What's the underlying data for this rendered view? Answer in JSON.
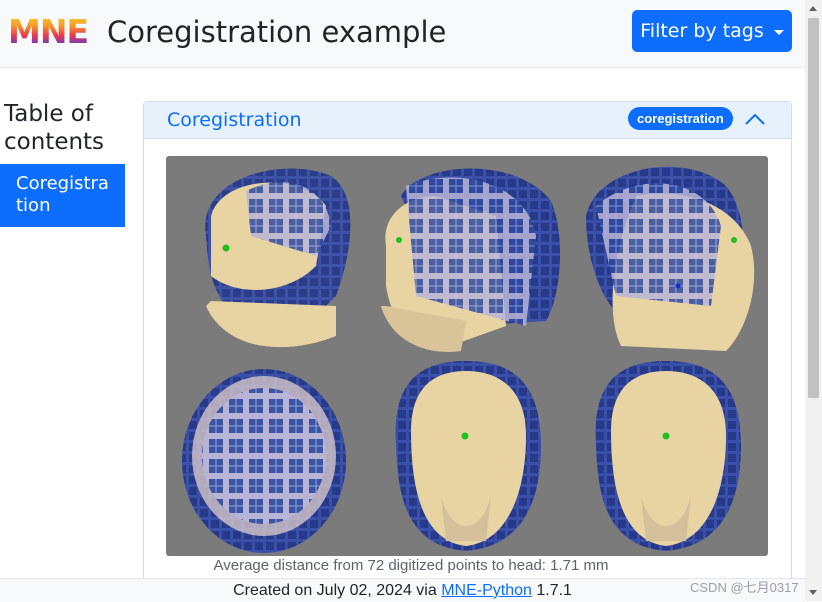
{
  "header": {
    "logo_text": "MNE",
    "title": "Coregistration example",
    "filter_button_label": "Filter by tags"
  },
  "toc": {
    "title": "Table of contents",
    "items": [
      {
        "label": "Coregistration"
      }
    ]
  },
  "section": {
    "title": "Coregistration",
    "tag": "coregistration",
    "figure_alt": "Six views of a head surface with MEG helmet and digitized points",
    "caption": "Average distance from 72 digitized points to head: 1.71 mm"
  },
  "footer": {
    "prefix": "Created on July 02, 2024 via ",
    "link_text": "MNE-Python",
    "suffix": " 1.7.1"
  },
  "watermark": "CSDN @七月0317",
  "colors": {
    "primary": "#0d6efd",
    "header_bg": "#e7f1fc",
    "figure_bg": "#7b7b7b",
    "skin": "#e8d3a3",
    "helmet": "#2f3f8f",
    "fiducial_green": "#1ec21e"
  }
}
